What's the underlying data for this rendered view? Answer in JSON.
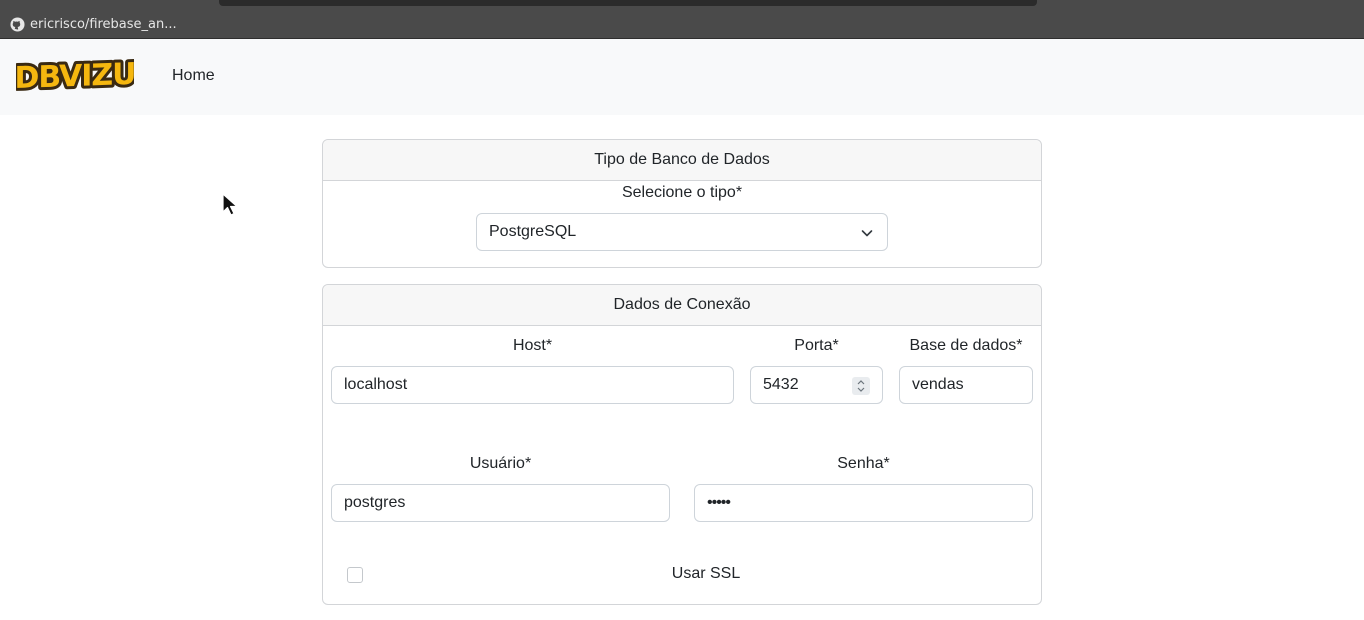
{
  "browser": {
    "status_url": "ericrisco/firebase_an..."
  },
  "navbar": {
    "logo_text": "DBVIZU",
    "home_label": "Home"
  },
  "db_type_card": {
    "title": "Tipo de Banco de Dados",
    "select_label": "Selecione o tipo*",
    "selected_value": "PostgreSQL"
  },
  "connection_card": {
    "title": "Dados de Conexão",
    "host_label": "Host*",
    "host_value": "localhost",
    "port_label": "Porta*",
    "port_value": "5432",
    "database_label": "Base de dados*",
    "database_value": "vendas",
    "user_label": "Usuário*",
    "user_value": "postgres",
    "password_label": "Senha*",
    "password_value": "•••••",
    "ssl_label": "Usar SSL",
    "ssl_checked": false
  },
  "colors": {
    "logo_fill": "#f5b70f",
    "logo_outline": "#3a2a12",
    "navbar_bg": "#f8f9fa",
    "card_header_bg": "#f7f7f7",
    "border": "#d3d5d8"
  }
}
